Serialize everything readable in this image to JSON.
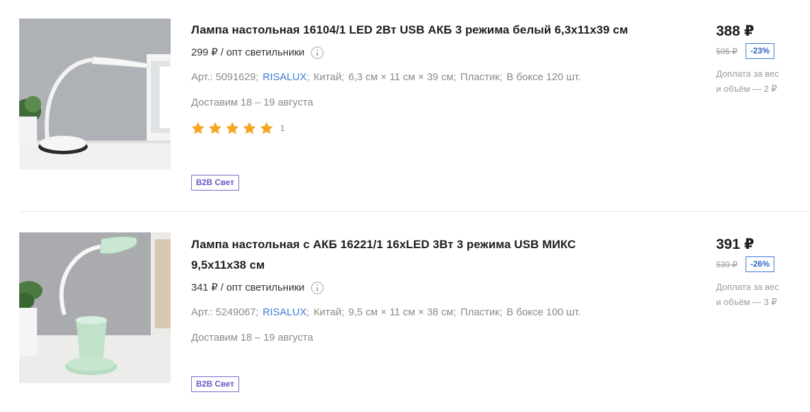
{
  "products": [
    {
      "title": "Лампа настольная 16104/1 LED 2Вт USB АКБ 3 режима белый 6,3х11х39 см",
      "opt_price": "299 ₽ / опт светильники",
      "article": "Арт.: 5091629;",
      "brand": "RISALUX",
      "country": "Китай;",
      "size": "6,3 см × 11 см × 39 см;",
      "material": "Пластик;",
      "box": "В боксе 120 шт.",
      "delivery": "Доставим 18 – 19 августа",
      "rating": 5,
      "reviews_count": "1",
      "badge": "B2B Свет",
      "price": "388 ₽",
      "old_price": "505 ₽",
      "discount": "-23%",
      "extra_line1": "Доплата за вес",
      "extra_line2": "и объём — 2 ₽",
      "image_icon": "white-desk-lamp-image"
    },
    {
      "title": "Лампа настольная с АКБ 16221/1 16хLED 3Вт 3 режима USB МИКС 9,5х11х38 см",
      "opt_price": "341 ₽ / опт светильники",
      "article": "Арт.: 5249067;",
      "brand": "RISALUX",
      "country": "Китай;",
      "size": "9,5 см × 11 см × 38 см;",
      "material": "Пластик;",
      "box": "В боксе 100 шт.",
      "delivery": "Доставим 18 – 19 августа",
      "badge": "B2B Свет",
      "price": "391 ₽",
      "old_price": "530 ₽",
      "discount": "-26%",
      "extra_line1": "Доплата за вес",
      "extra_line2": "и объём — 3 ₽",
      "image_icon": "mint-desk-lamp-image"
    }
  ],
  "colors": {
    "brand_link": "#3b7bd4",
    "star": "#f5a623",
    "badge_border": "#7a68c9",
    "discount_border": "#3b7bd4"
  }
}
